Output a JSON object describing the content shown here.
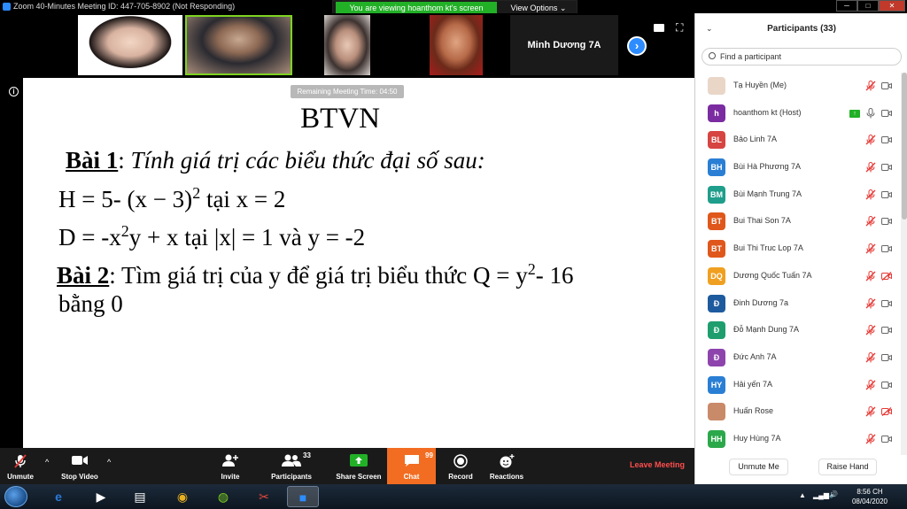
{
  "titlebar": {
    "title": "Zoom 40-Minutes Meeting ID: 447-705-8902  (Not Responding)",
    "viewing_banner": "You are viewing hoanthom kt's screen",
    "view_options": "View Options ⌄",
    "minimize": "─",
    "maximize": "□",
    "close": "✕"
  },
  "gallery": {
    "named_tile": "Minh Dương 7A"
  },
  "main": {
    "timer": "Remaining Meeting Time: 04:50"
  },
  "slide": {
    "title": "BTVN",
    "l1_label": "Bài 1",
    "l1_sep": ":  ",
    "l1_text": "Tính giá trị các biểu thức đại số sau:",
    "l2_text": "H = 5- (x − 3)",
    "l2_sup": "2",
    "l2_tail": " tại x = 2",
    "l3_text": "D = -x",
    "l3_sup": "2",
    "l3_tail": "y + x tại |x| = 1 và y = -2",
    "l4_label": "Bài 2",
    "l4_text": ": Tìm giá trị của y để giá trị biểu thức Q = y",
    "l4_sup": "2",
    "l4_tail": "- 16",
    "l5_text": "bằng 0"
  },
  "toolbar": {
    "unmute": "Unmute",
    "stop_video": "Stop Video",
    "invite": "Invite",
    "participants": "Participants",
    "participants_count": "33",
    "share_screen": "Share Screen",
    "chat": "Chat",
    "chat_count": "99",
    "record": "Record",
    "reactions": "Reactions",
    "leave": "Leave Meeting",
    "caret": "^"
  },
  "participants_panel": {
    "title": "Participants (33)",
    "search_placeholder": "Find a participant",
    "items": [
      {
        "name": "Tạ Huyền (Me)",
        "initials": "",
        "color": "#e9d6c7",
        "mic": "muted",
        "cam": "off"
      },
      {
        "name": "hoanthom kt (Host)",
        "initials": "h",
        "color": "#7b2ca1",
        "mic": "on",
        "cam": "off",
        "sharing": true
      },
      {
        "name": "Bảo Linh 7A",
        "initials": "BL",
        "color": "#d64541",
        "mic": "muted",
        "cam": "off"
      },
      {
        "name": "Bùi Hà Phương 7A",
        "initials": "BH",
        "color": "#2a7fd4",
        "mic": "muted",
        "cam": "off"
      },
      {
        "name": "Bùi Mạnh Trung 7A",
        "initials": "BM",
        "color": "#1e9e8b",
        "mic": "muted",
        "cam": "off"
      },
      {
        "name": "Bui Thai Son 7A",
        "initials": "BT",
        "color": "#e0571b",
        "mic": "muted",
        "cam": "off"
      },
      {
        "name": "Bui Thi Truc Lop 7A",
        "initials": "BT",
        "color": "#e0571b",
        "mic": "muted",
        "cam": "off"
      },
      {
        "name": "Dương Quốc Tuấn 7A",
        "initials": "DQ",
        "color": "#f0a020",
        "mic": "muted",
        "cam": "blocked"
      },
      {
        "name": "Đinh Dương 7a",
        "initials": "Đ",
        "color": "#1e5a9e",
        "mic": "muted",
        "cam": "off"
      },
      {
        "name": "Đỗ Mạnh Dung 7A",
        "initials": "Đ",
        "color": "#1e9e6e",
        "mic": "muted",
        "cam": "off"
      },
      {
        "name": "Đức Anh 7A",
        "initials": "Đ",
        "color": "#8e44ad",
        "mic": "muted",
        "cam": "off"
      },
      {
        "name": "Hải yến 7A",
        "initials": "HY",
        "color": "#2a7fd4",
        "mic": "muted",
        "cam": "off"
      },
      {
        "name": "Huấn Rose",
        "initials": "",
        "color": "#c98a6a",
        "mic": "muted",
        "cam": "blocked"
      },
      {
        "name": "Huy Hùng 7A",
        "initials": "HH",
        "color": "#2ba84a",
        "mic": "muted",
        "cam": "off"
      }
    ],
    "unmute_me": "Unmute Me",
    "raise_hand": "Raise Hand"
  },
  "taskbar": {
    "time": "8:56 CH",
    "date": "08/04/2020",
    "tray_arrow": "▲"
  },
  "colors": {
    "accent": "#2d8cff",
    "viewing_green": "#22b027",
    "chat_orange": "#f26d21",
    "leave_red": "#ff4d4d",
    "muted_red": "#e53935"
  }
}
